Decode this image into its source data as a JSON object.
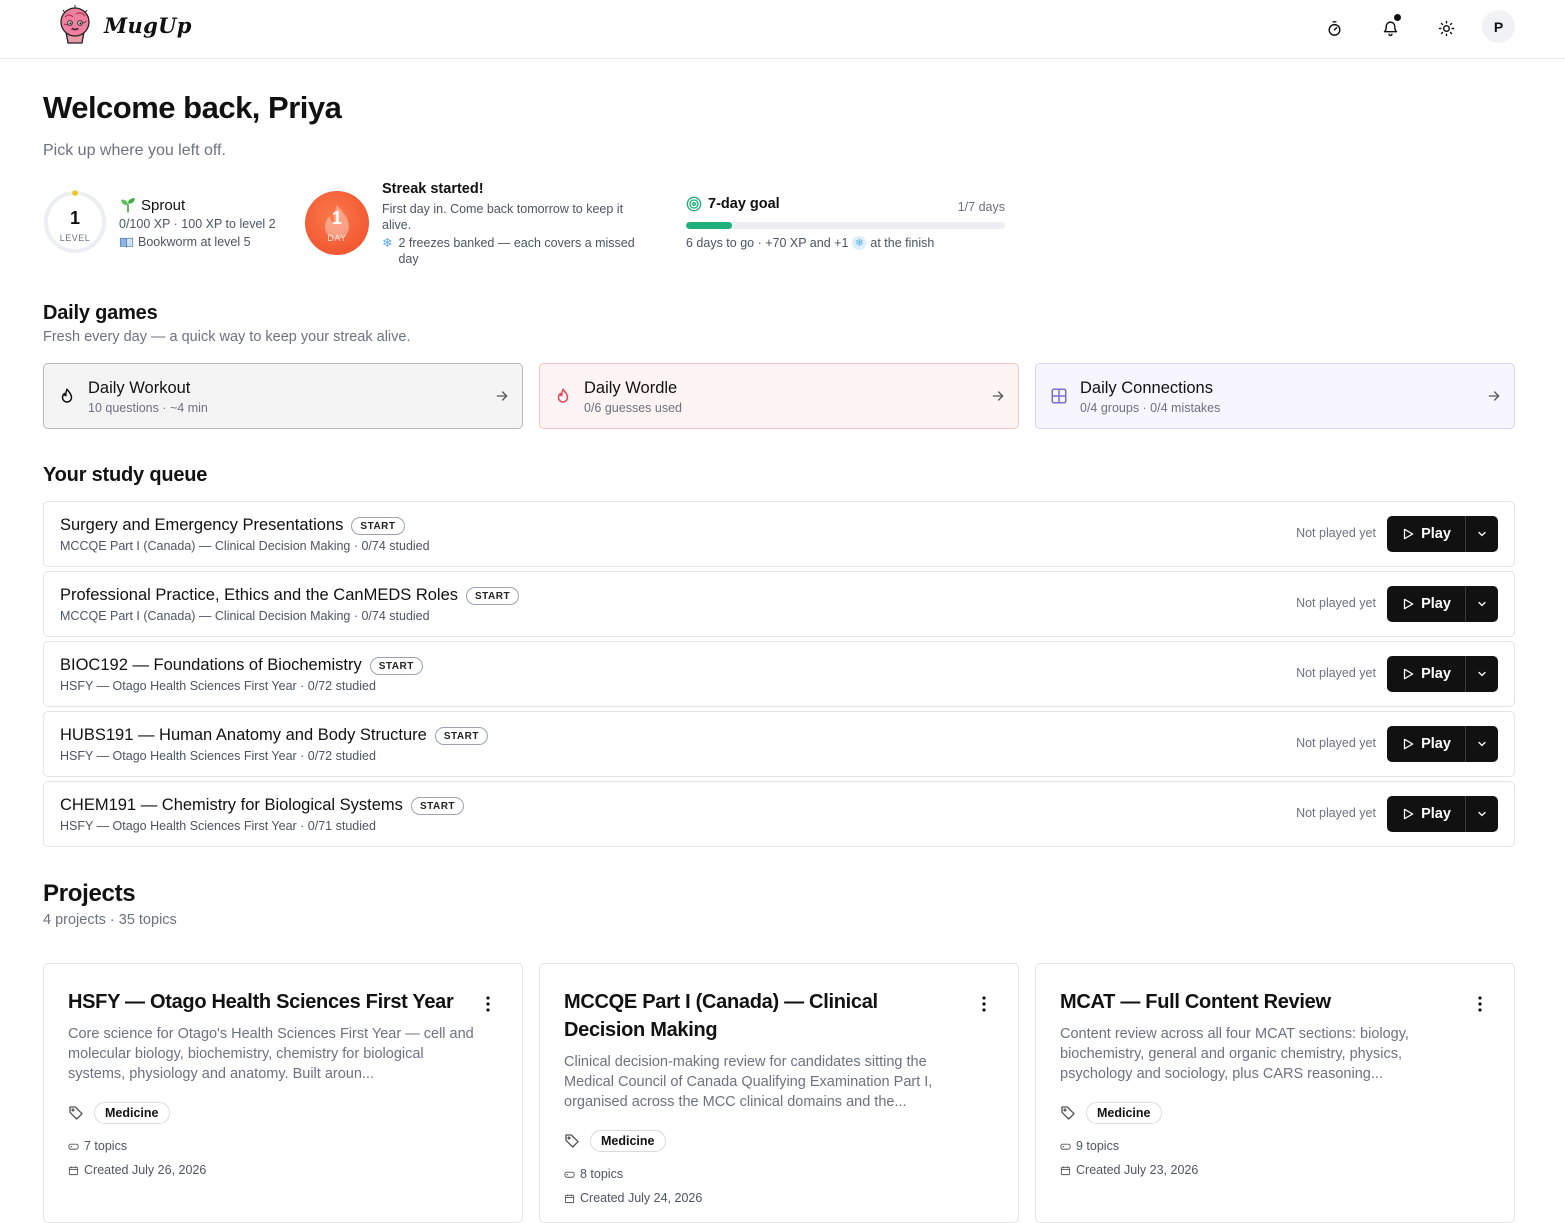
{
  "brand": {
    "name": "MugUp"
  },
  "header": {
    "avatar_initial": "P"
  },
  "welcome": {
    "title": "Welcome back, Priya",
    "subtitle": "Pick up where you left off."
  },
  "level": {
    "number": "1",
    "label": "LEVEL",
    "title": "Sprout",
    "xp_line": "0/100 XP · 100 XP to level 2",
    "next_line": "Bookworm at level 5"
  },
  "streak": {
    "number": "1",
    "label": "DAY",
    "title": "Streak started!",
    "text": "First day in. Come back tomorrow to keep it alive.",
    "freeze_text": "2 freezes banked — each covers a missed day"
  },
  "goal": {
    "title": "7-day goal",
    "days": "1/7 days",
    "progress_fraction": 0.143,
    "sub_before": "6 days to go · +70 XP and +1",
    "sub_after": "at the finish",
    "colors": {
      "fill": "#1db07a"
    }
  },
  "daily_games": {
    "title": "Daily games",
    "subtitle": "Fresh every day — a quick way to keep your streak alive.",
    "items": [
      {
        "name": "Daily Workout",
        "sub": "10 questions · ~4 min",
        "icon": "flame-icon",
        "bg": "#f4f4f5",
        "border": "#b6b9bf"
      },
      {
        "name": "Daily Wordle",
        "sub": "0/6 guesses used",
        "icon": "flame-icon",
        "bg": "#fff4f4",
        "border": "#f5c2c7"
      },
      {
        "name": "Daily Connections",
        "sub": "0/4 groups · 0/4 mistakes",
        "icon": "grid-icon",
        "bg": "#f7f6fe",
        "border": "#d7d2f3"
      }
    ]
  },
  "queue": {
    "title": "Your study queue",
    "status_text": "Not played yet",
    "play_label": "Play",
    "badge": "START",
    "items": [
      {
        "title": "Surgery and Emergency Presentations",
        "sub": "MCCQE Part I (Canada) — Clinical Decision Making · 0/74 studied"
      },
      {
        "title": "Professional Practice, Ethics and the CanMEDS Roles",
        "sub": "MCCQE Part I (Canada) — Clinical Decision Making · 0/74 studied"
      },
      {
        "title": "BIOC192 — Foundations of Biochemistry",
        "sub": "HSFY — Otago Health Sciences First Year · 0/72 studied"
      },
      {
        "title": "HUBS191 — Human Anatomy and Body Structure",
        "sub": "HSFY — Otago Health Sciences First Year · 0/72 studied"
      },
      {
        "title": "CHEM191 — Chemistry for Biological Systems",
        "sub": "HSFY — Otago Health Sciences First Year · 0/71 studied"
      }
    ]
  },
  "projects": {
    "title": "Projects",
    "subtitle": "4 projects · 35 topics",
    "items": [
      {
        "title": "HSFY — Otago Health Sciences First Year",
        "desc": "Core science for Otago's Health Sciences First Year — cell and molecular biology, biochemistry, chemistry for biological systems, physiology and anatomy. Built aroun...",
        "tag": "Medicine",
        "topics": "7 topics",
        "created": "Created July 26, 2026"
      },
      {
        "title": "MCCQE Part I (Canada) — Clinical Decision Making",
        "desc": "Clinical decision-making review for candidates sitting the Medical Council of Canada Qualifying Examination Part I, organised across the MCC clinical domains and the...",
        "tag": "Medicine",
        "topics": "8 topics",
        "created": "Created July 24, 2026"
      },
      {
        "title": "MCAT — Full Content Review",
        "desc": "Content review across all four MCAT sections: biology, biochemistry, general and organic chemistry, physics, psychology and sociology, plus CARS reasoning...",
        "tag": "Medicine",
        "topics": "9 topics",
        "created": "Created July 23, 2026"
      }
    ]
  }
}
